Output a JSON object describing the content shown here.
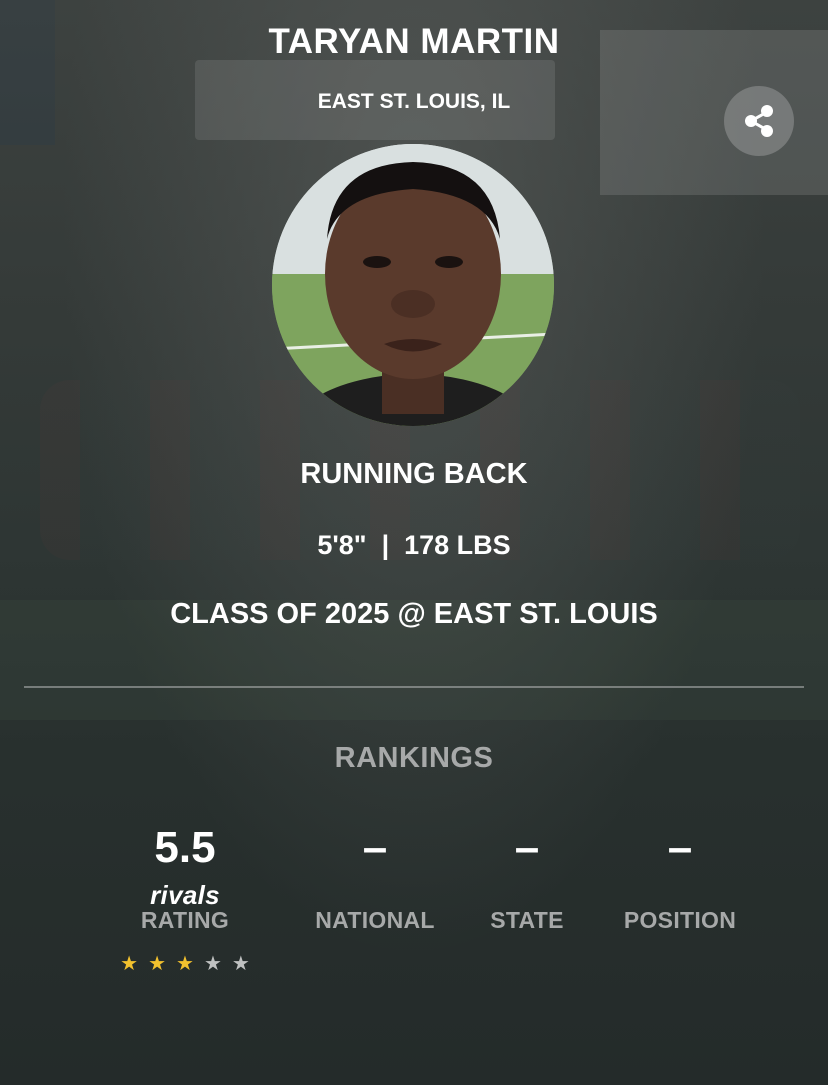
{
  "player": {
    "name": "TARYAN MARTIN",
    "hometown": "EAST ST. LOUIS, IL",
    "position": "RUNNING BACK",
    "measurements": "5'8\"  |  178 LBS",
    "class_line": "CLASS OF 2025 @ EAST ST. LOUIS"
  },
  "share": {
    "icon": "share-icon"
  },
  "rankings": {
    "title": "RANKINGS",
    "rating": {
      "value": "5.5",
      "brand": "rivals",
      "label": "RATING",
      "stars_filled": 3,
      "stars_total": 5
    },
    "national": {
      "value": "–",
      "label": "NATIONAL"
    },
    "state": {
      "value": "–",
      "label": "STATE"
    },
    "position": {
      "value": "–",
      "label": "POSITION"
    }
  },
  "colors": {
    "star_active": "#f2c12e",
    "star_inactive": "#bfc1c1",
    "label_gray": "#a7a9a9"
  }
}
